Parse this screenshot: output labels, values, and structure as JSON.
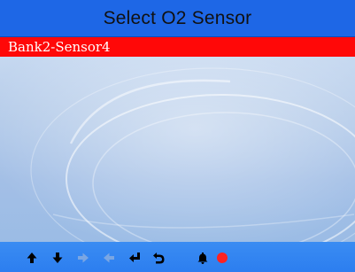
{
  "title": "Select O2 Sensor",
  "list": {
    "items": [
      {
        "label": "Bank2-Sensor4",
        "selected": true
      }
    ]
  },
  "toolbar": {
    "icons": [
      "arrow-up-icon",
      "arrow-down-icon",
      "arrow-right-icon",
      "arrow-left-icon",
      "enter-icon",
      "back-icon",
      "bell-icon",
      "record-icon"
    ]
  },
  "colors": {
    "title_bar": "#1e67e6",
    "selection": "#ff0808",
    "toolbar": "#2c7ef0",
    "icon_active": "#000000",
    "icon_disabled": "#7aa6e3",
    "record": "#ff2222"
  }
}
